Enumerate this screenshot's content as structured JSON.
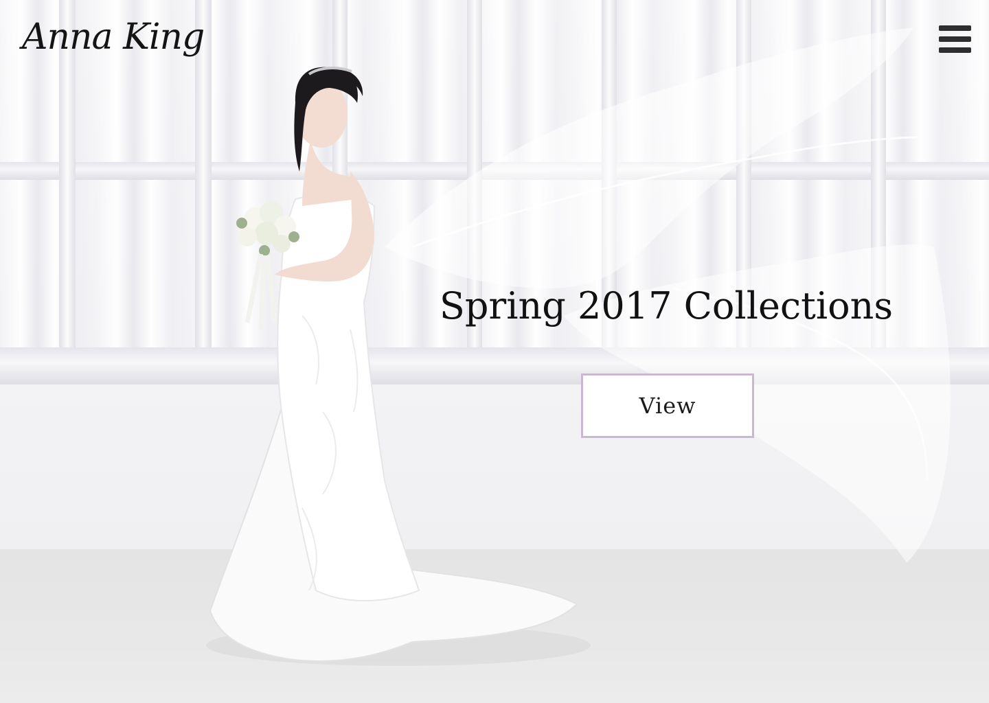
{
  "header": {
    "brand": "Anna King",
    "menu_icon": "hamburger-menu-icon"
  },
  "hero": {
    "headline": "Spring 2017 Collections",
    "cta_label": "View",
    "cta_border_color": "#c9b8d2",
    "photo_description_icon": "bride-photo"
  },
  "colors": {
    "text": "#111111",
    "menu_icon": "#2e2e30",
    "button_bg": "#ffffff",
    "button_border": "#c9b8d2"
  }
}
